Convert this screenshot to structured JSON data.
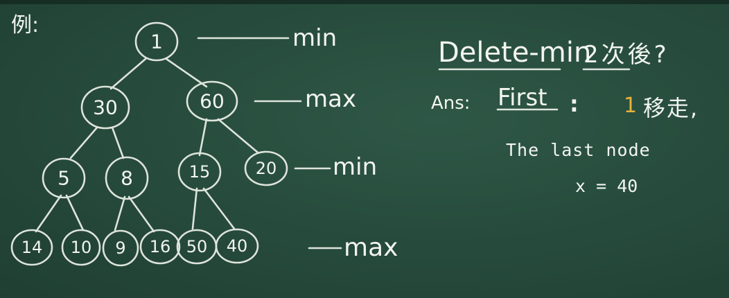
{
  "example_label": "例:",
  "tree": {
    "nodes": [
      {
        "id": "n1",
        "value": "1"
      },
      {
        "id": "n2",
        "value": "30"
      },
      {
        "id": "n3",
        "value": "60"
      },
      {
        "id": "n4",
        "value": "5"
      },
      {
        "id": "n5",
        "value": "8"
      },
      {
        "id": "n6",
        "value": "15"
      },
      {
        "id": "n7",
        "value": "20"
      },
      {
        "id": "n8",
        "value": "14"
      },
      {
        "id": "n9",
        "value": "10"
      },
      {
        "id": "n10",
        "value": "9"
      },
      {
        "id": "n11",
        "value": "16"
      },
      {
        "id": "n12",
        "value": "50"
      },
      {
        "id": "n13",
        "value": "40"
      }
    ],
    "level_labels": [
      "min",
      "max",
      "min",
      "max"
    ]
  },
  "right": {
    "heading": "Delete-min",
    "question": "2次後?",
    "ans_label": "Ans:",
    "first_label": "First",
    "colon": ":",
    "step_number": "1",
    "step_text": "移走,",
    "last_node_text": "The last node",
    "x_value": "x = 40"
  },
  "colors": {
    "board": "#274c3d",
    "chalk": "#f2f5ef",
    "highlight": "#e8b23a"
  }
}
